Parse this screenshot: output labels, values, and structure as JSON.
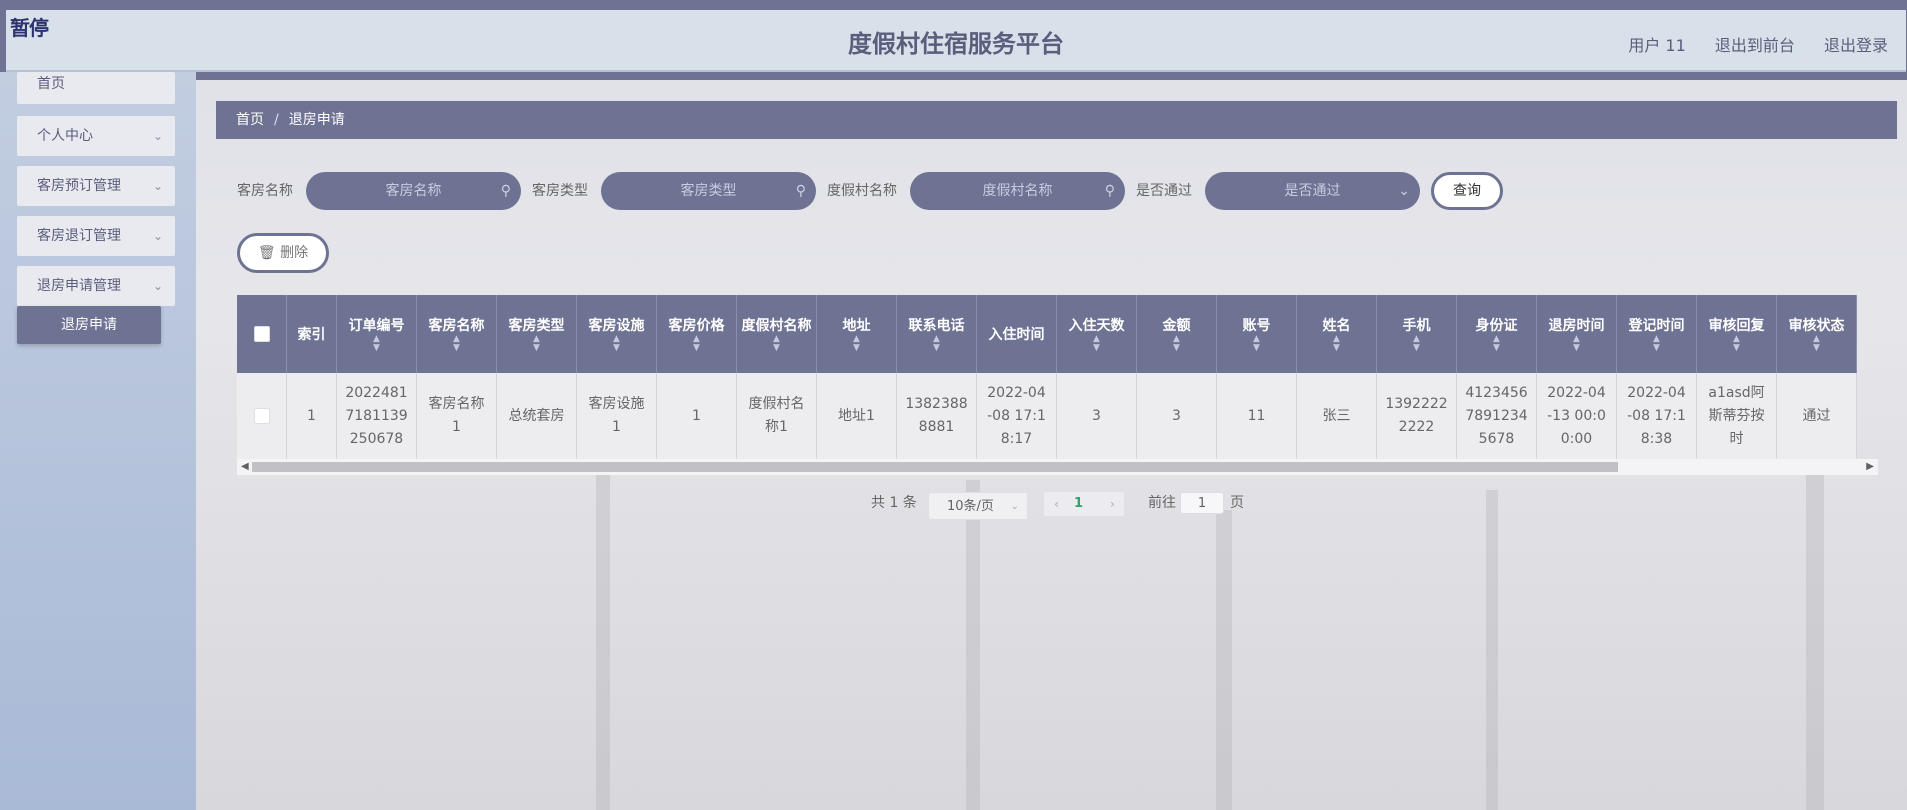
{
  "header": {
    "logo_text": "暂停",
    "title": "度假村住宿服务平台",
    "links": [
      "用户 11",
      "退出到前台",
      "退出登录"
    ]
  },
  "sidebar": {
    "items": [
      {
        "label": "首页"
      },
      {
        "label": "个人中心"
      },
      {
        "label": "客房预订管理"
      },
      {
        "label": "客房退订管理"
      },
      {
        "label": "退房申请管理"
      }
    ],
    "active_sub": "退房申请"
  },
  "breadcrumb": {
    "home": "首页",
    "sep": "/",
    "current": "退房申请"
  },
  "search": {
    "fields": [
      {
        "label": "客房名称",
        "placeholder": "客房名称",
        "icon": "search-icon"
      },
      {
        "label": "客房类型",
        "placeholder": "客房类型",
        "icon": "search-icon"
      },
      {
        "label": "度假村名称",
        "placeholder": "度假村名称",
        "icon": "search-icon"
      },
      {
        "label": "是否通过",
        "placeholder": "是否通过",
        "icon": "chevron-down-icon"
      }
    ],
    "query_button": "查询"
  },
  "actions": {
    "delete_button": "删除"
  },
  "table": {
    "columns": [
      "",
      "索引",
      "订单编号",
      "客房名称",
      "客房类型",
      "客房设施",
      "客房价格",
      "度假村名称",
      "地址",
      "联系电话",
      "入住时间",
      "入住天数",
      "金额",
      "账号",
      "姓名",
      "手机",
      "身份证",
      "退房时间",
      "登记时间",
      "审核回复",
      "审核状态"
    ],
    "rows": [
      [
        "",
        "1",
        "2022481718 1139250678",
        "客房名称1",
        "总统套房",
        "客房设施1",
        "1",
        "度假村名称1",
        "地址1",
        "13823888881",
        "2022-04-08 17:18:17",
        "3",
        "3",
        "11",
        "张三",
        "13922222222",
        "412345678912345678",
        "2022-04-13 00:00:00",
        "2022-04-08 17:18:38",
        "a1asd阿斯蒂芬按时",
        "通过"
      ]
    ],
    "row_lines": [
      [
        "",
        "1",
        "2022481|7181139|250678",
        "客房名称|1",
        "总统套房",
        "客房设施|1",
        "1",
        "度假村名|称1",
        "地址1",
        "1382388|8881",
        "2022-04|-08 17:1|8:17",
        "3",
        "3",
        "11",
        "张三",
        "1392222|2222",
        "4123456|7891234|5678",
        "2022-04|-13 00:0|0:00",
        "2022-04|-08 17:1|8:38",
        "a1asd阿|斯蒂芬按|时",
        "通过"
      ]
    ]
  },
  "pagination": {
    "total": "共 1 条",
    "page_size": "10条/页",
    "current_page": "1",
    "goto_label": "前往",
    "goto_value": "1",
    "page_suffix": "页"
  }
}
